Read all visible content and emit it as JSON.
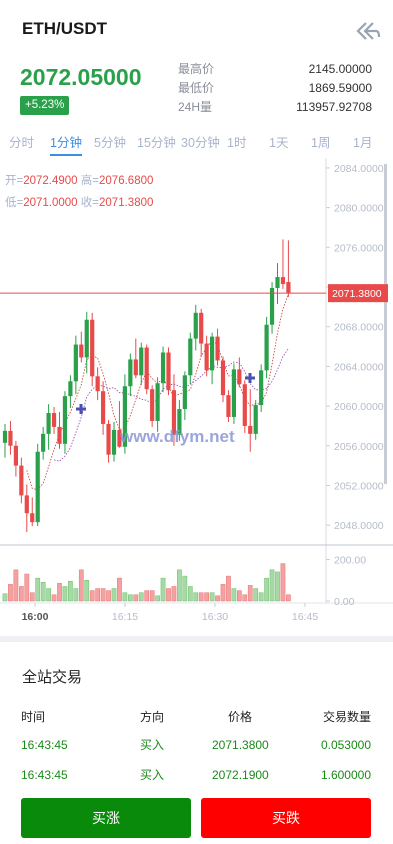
{
  "header": {
    "title": "ETH/USDT"
  },
  "ticker": {
    "last_price": "2072.05000",
    "change": "+5.23%",
    "stats": [
      {
        "label": "最高价",
        "value": "2145.00000"
      },
      {
        "label": "最低价",
        "value": "1869.59000"
      },
      {
        "label": "24H量",
        "value": "113957.92708"
      }
    ]
  },
  "tabs": [
    {
      "label": "分时",
      "active": false
    },
    {
      "label": "1分钟",
      "active": true
    },
    {
      "label": "5分钟",
      "active": false
    },
    {
      "label": "15分钟",
      "active": false
    },
    {
      "label": "30分钟",
      "active": false
    },
    {
      "label": "1时",
      "active": false
    },
    {
      "label": "1天",
      "active": false
    },
    {
      "label": "1周",
      "active": false
    },
    {
      "label": "1月",
      "active": false
    }
  ],
  "ohlc": {
    "open_label": "开=",
    "open": "2072.4900",
    "high_label": "高=",
    "high": "2076.6800",
    "low_label": "低=",
    "low": "2071.0000",
    "close_label": "收=",
    "close": "2071.3800"
  },
  "watermark": "www.dfym.net",
  "colors": {
    "up": "#2aa04a",
    "down": "#e84a4a",
    "accent": "#3a8ee6",
    "buy": "#0a8a0a",
    "sell": "#ff0000"
  },
  "chart_data": {
    "type": "candlestick",
    "price_axis": {
      "ticks": [
        "2084.0000",
        "2080.0000",
        "2076.0000",
        "2072.0000",
        "2068.0000",
        "2064.0000",
        "2060.0000",
        "2056.0000",
        "2052.0000",
        "2048.0000"
      ],
      "ylim": [
        2046,
        2085
      ]
    },
    "current_price_label": "2071.3800",
    "current_price": 2071.38,
    "volume_axis": {
      "ticks": [
        "200.00",
        "0.00"
      ],
      "ylim": [
        0,
        260
      ]
    },
    "time_ticks": [
      "16:00",
      "16:15",
      "16:30",
      "16:45"
    ],
    "candles": [
      {
        "o": 2056.3,
        "h": 2058.2,
        "l": 2054.8,
        "c": 2057.5
      },
      {
        "o": 2057.5,
        "h": 2058.5,
        "l": 2055.1,
        "c": 2056.0
      },
      {
        "o": 2056.0,
        "h": 2056.5,
        "l": 2052.9,
        "c": 2054.0
      },
      {
        "o": 2054.0,
        "h": 2054.8,
        "l": 2050.2,
        "c": 2051.0
      },
      {
        "o": 2051.0,
        "h": 2052.1,
        "l": 2047.3,
        "c": 2049.2
      },
      {
        "o": 2049.2,
        "h": 2050.8,
        "l": 2047.9,
        "c": 2048.3
      },
      {
        "o": 2048.3,
        "h": 2056.2,
        "l": 2047.9,
        "c": 2055.4
      },
      {
        "o": 2055.4,
        "h": 2057.9,
        "l": 2054.6,
        "c": 2057.2
      },
      {
        "o": 2057.2,
        "h": 2060.2,
        "l": 2055.6,
        "c": 2059.3
      },
      {
        "o": 2059.3,
        "h": 2059.9,
        "l": 2057.2,
        "c": 2057.9
      },
      {
        "o": 2057.9,
        "h": 2059.4,
        "l": 2055.7,
        "c": 2056.2
      },
      {
        "o": 2056.2,
        "h": 2061.5,
        "l": 2055.2,
        "c": 2061.0
      },
      {
        "o": 2061.0,
        "h": 2063.1,
        "l": 2059.8,
        "c": 2062.5
      },
      {
        "o": 2062.5,
        "h": 2067.1,
        "l": 2061.2,
        "c": 2066.2
      },
      {
        "o": 2066.2,
        "h": 2067.5,
        "l": 2064.4,
        "c": 2064.9
      },
      {
        "o": 2064.9,
        "h": 2069.5,
        "l": 2063.3,
        "c": 2068.7
      },
      {
        "o": 2068.7,
        "h": 2069.4,
        "l": 2062.0,
        "c": 2063.0
      },
      {
        "o": 2063.0,
        "h": 2063.9,
        "l": 2060.6,
        "c": 2061.5
      },
      {
        "o": 2061.5,
        "h": 2062.5,
        "l": 2057.1,
        "c": 2058.2
      },
      {
        "o": 2058.2,
        "h": 2058.6,
        "l": 2054.3,
        "c": 2055.1
      },
      {
        "o": 2055.1,
        "h": 2058.4,
        "l": 2054.4,
        "c": 2057.6
      },
      {
        "o": 2057.6,
        "h": 2060.5,
        "l": 2055.8,
        "c": 2055.9
      },
      {
        "o": 2055.9,
        "h": 2063.2,
        "l": 2055.2,
        "c": 2062.0
      },
      {
        "o": 2062.0,
        "h": 2065.3,
        "l": 2061.0,
        "c": 2064.7
      },
      {
        "o": 2064.7,
        "h": 2066.8,
        "l": 2062.8,
        "c": 2063.1
      },
      {
        "o": 2063.1,
        "h": 2066.4,
        "l": 2062.1,
        "c": 2065.9
      },
      {
        "o": 2065.9,
        "h": 2066.2,
        "l": 2061.2,
        "c": 2061.7
      },
      {
        "o": 2061.7,
        "h": 2062.1,
        "l": 2057.9,
        "c": 2058.5
      },
      {
        "o": 2058.5,
        "h": 2062.9,
        "l": 2057.4,
        "c": 2062.3
      },
      {
        "o": 2062.3,
        "h": 2066.0,
        "l": 2061.4,
        "c": 2065.4
      },
      {
        "o": 2065.4,
        "h": 2065.9,
        "l": 2061.1,
        "c": 2061.6
      },
      {
        "o": 2061.6,
        "h": 2063.2,
        "l": 2056.0,
        "c": 2057.1
      },
      {
        "o": 2057.1,
        "h": 2060.6,
        "l": 2056.5,
        "c": 2059.7
      },
      {
        "o": 2059.7,
        "h": 2063.5,
        "l": 2058.6,
        "c": 2063.1
      },
      {
        "o": 2063.1,
        "h": 2067.4,
        "l": 2062.2,
        "c": 2066.8
      },
      {
        "o": 2066.8,
        "h": 2070.2,
        "l": 2065.6,
        "c": 2069.4
      },
      {
        "o": 2069.4,
        "h": 2069.8,
        "l": 2065.0,
        "c": 2066.3
      },
      {
        "o": 2066.3,
        "h": 2067.1,
        "l": 2063.0,
        "c": 2063.6
      },
      {
        "o": 2063.6,
        "h": 2067.4,
        "l": 2062.2,
        "c": 2067.0
      },
      {
        "o": 2067.0,
        "h": 2067.8,
        "l": 2064.1,
        "c": 2064.6
      },
      {
        "o": 2064.6,
        "h": 2065.0,
        "l": 2060.4,
        "c": 2061.1
      },
      {
        "o": 2061.1,
        "h": 2061.6,
        "l": 2058.4,
        "c": 2058.9
      },
      {
        "o": 2058.9,
        "h": 2064.3,
        "l": 2058.2,
        "c": 2063.7
      },
      {
        "o": 2063.7,
        "h": 2064.9,
        "l": 2061.9,
        "c": 2062.2
      },
      {
        "o": 2062.2,
        "h": 2062.6,
        "l": 2057.3,
        "c": 2058.0
      },
      {
        "o": 2058.0,
        "h": 2061.7,
        "l": 2055.4,
        "c": 2057.2
      },
      {
        "o": 2057.2,
        "h": 2060.6,
        "l": 2056.6,
        "c": 2060.1
      },
      {
        "o": 2060.1,
        "h": 2064.2,
        "l": 2059.4,
        "c": 2063.6
      },
      {
        "o": 2063.6,
        "h": 2069.0,
        "l": 2062.8,
        "c": 2068.2
      },
      {
        "o": 2068.2,
        "h": 2072.5,
        "l": 2067.3,
        "c": 2071.9
      },
      {
        "o": 2071.9,
        "h": 2074.4,
        "l": 2070.3,
        "c": 2073.0
      },
      {
        "o": 2073.0,
        "h": 2076.8,
        "l": 2071.8,
        "c": 2072.3
      },
      {
        "o": 2072.5,
        "h": 2076.7,
        "l": 2071.0,
        "c": 2071.4
      }
    ],
    "volumes": [
      35,
      80,
      150,
      70,
      130,
      40,
      110,
      90,
      60,
      30,
      85,
      70,
      95,
      60,
      150,
      100,
      50,
      60,
      60,
      50,
      60,
      110,
      40,
      30,
      30,
      40,
      50,
      50,
      25,
      110,
      60,
      70,
      150,
      120,
      70,
      40,
      40,
      40,
      40,
      25,
      80,
      120,
      60,
      50,
      30,
      75,
      60,
      40,
      110,
      150,
      140,
      180,
      30
    ]
  },
  "trades": {
    "title": "全站交易",
    "headers": {
      "time": "时间",
      "side": "方向",
      "price": "价格",
      "amount": "交易数量"
    },
    "rows": [
      {
        "time": "16:43:45",
        "side": "买入",
        "price": "2071.3800",
        "amount": "0.053000"
      },
      {
        "time": "16:43:45",
        "side": "买入",
        "price": "2072.1900",
        "amount": "1.600000"
      }
    ]
  },
  "actions": {
    "buy_label": "买涨",
    "sell_label": "买跌"
  }
}
